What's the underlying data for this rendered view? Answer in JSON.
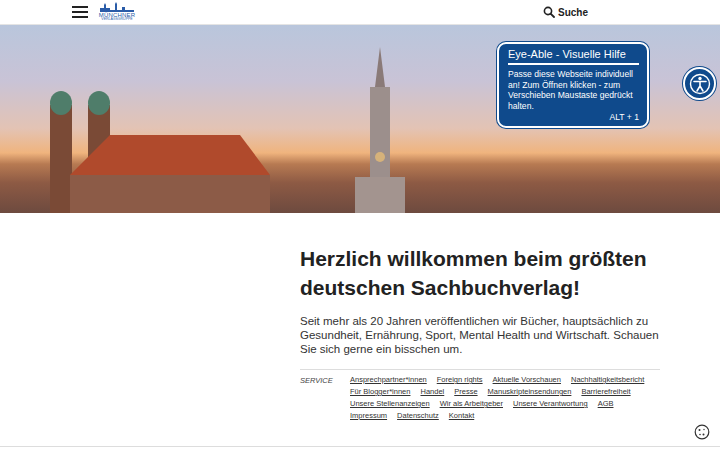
{
  "header": {
    "logo": {
      "line1": "MÜNCHNER",
      "line2": "VERLAGSGRUPPE"
    },
    "search": "Suche"
  },
  "tooltip": {
    "title": "Eye-Able - Visuelle Hilfe",
    "text": "Passe diese Webseite individuell an! Zum Öffnen klicken - zum Verschieben Maustaste gedrückt halten.",
    "shortcut": "ALT + 1"
  },
  "intro": {
    "heading": "Herzlich willkommen beim größten deutschen Sachbuchverlag!",
    "text": "Seit mehr als 20 Jahren veröffentlichen wir Bücher, hauptsächlich zu Gesundheit, Ernährung, Sport, Mental Health und Wirtschaft. Schauen Sie sich gerne ein bisschen um."
  },
  "service": {
    "label": "SERVICE",
    "links": [
      "Ansprechpartner*innen",
      "Foreign rights",
      "Aktuelle Vorschauen",
      "Nachhaltigkeitsbericht",
      "Für Blogger*innen",
      "Handel",
      "Presse",
      "Manuskripteinsendungen",
      "Barrierefreiheit",
      "Unsere Stellenanzeigen",
      "Wir als Arbeitgeber",
      "Unsere Verantwortung",
      "AGB",
      "Impressum",
      "Datenschutz",
      "Kontakt"
    ]
  }
}
